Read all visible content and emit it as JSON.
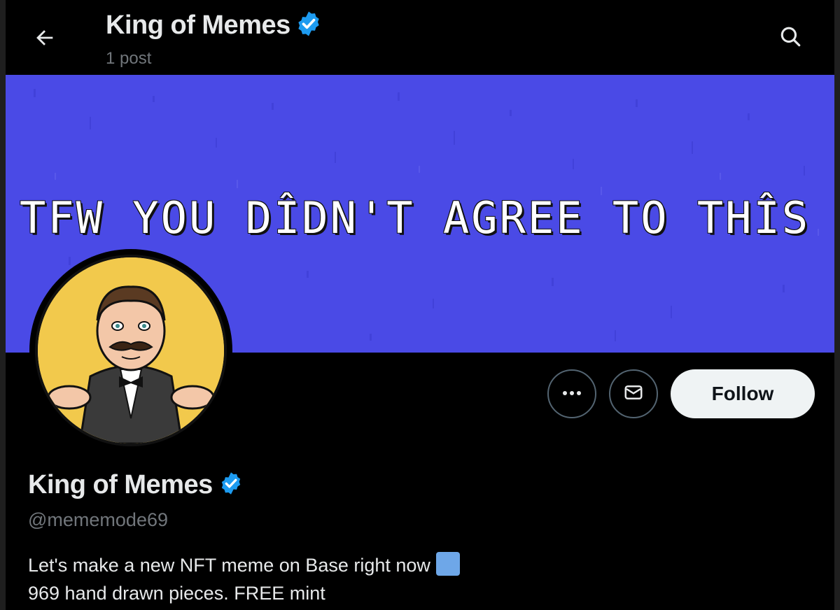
{
  "header": {
    "name": "King of Memes",
    "post_count": "1 post"
  },
  "banner": {
    "text": "TFW YOU DÎDN'T AGREE TO THÎS",
    "background_color": "#4a4ae6"
  },
  "profile": {
    "name": "King of Memes",
    "handle": "@mememode69",
    "bio_line1": "Let's make a new NFT meme on Base right now",
    "bio_line2": "969 hand drawn pieces. FREE mint",
    "verified": true
  },
  "actions": {
    "follow_label": "Follow",
    "more_icon": "more-icon",
    "message_icon": "message-icon"
  },
  "colors": {
    "accent_verified": "#1d9bf0",
    "follow_bg": "#eff3f4",
    "avatar_bg": "#f2c94c"
  }
}
